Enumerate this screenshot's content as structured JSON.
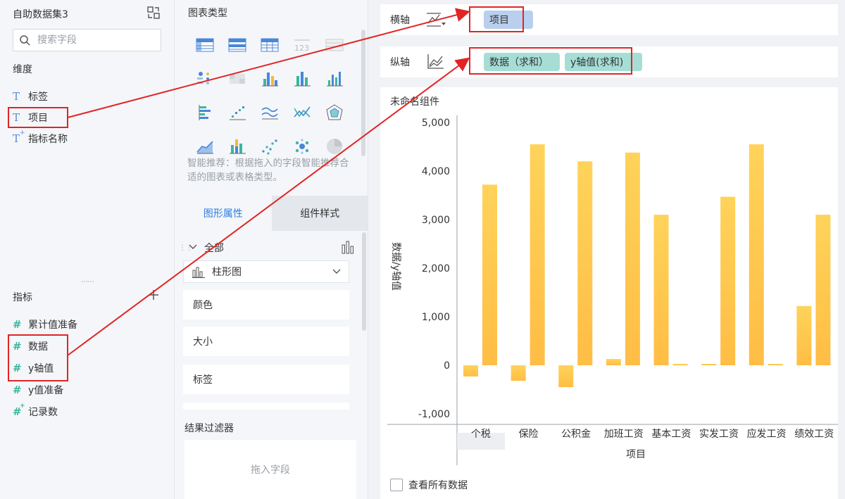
{
  "left": {
    "dataset_title": "自助数据集3",
    "search_placeholder": "搜索字段",
    "dimension_title": "维度",
    "dimensions": [
      "标签",
      "项目",
      "指标名称"
    ],
    "measure_title": "指标",
    "measures": [
      "累计值准备",
      "数据",
      "y轴值",
      "y值准备",
      "记录数"
    ],
    "add_icon": "plus-icon"
  },
  "middle": {
    "chart_type_title": "图表类型",
    "recommend_text": "智能推荐：根据拖入的字段智能推荐合适的图表或表格类型。",
    "tabs": [
      "图形属性",
      "组件样式"
    ],
    "all_label": "全部",
    "chart_type_value": "柱形图",
    "properties": [
      "颜色",
      "大小",
      "标签"
    ],
    "filter_title": "结果过滤器",
    "filter_placeholder": "拖入字段"
  },
  "right": {
    "x_axis_label": "横轴",
    "x_axis_fields": [
      "项目"
    ],
    "y_axis_label": "纵轴",
    "y_axis_fields": [
      "数据（求和）",
      "y轴值(求和)"
    ],
    "component_title": "未命名组件",
    "show_all_label": "查看所有数据"
  },
  "colors": {
    "accent": "#2f7de1",
    "bar_top": "#ffd35a",
    "bar_bottom": "#ffbd45",
    "annotation": "#e22424",
    "pill_blue": "#b9cfee",
    "pill_teal": "#a6ded6"
  },
  "chart_data": {
    "type": "bar",
    "xlabel": "项目",
    "ylabel": "数据/y轴值",
    "ylim": [
      -1000,
      5000
    ],
    "yticks": [
      "5,000",
      "4,000",
      "3,000",
      "2,000",
      "1,000",
      "0",
      "-1,000"
    ],
    "categories": [
      "个税",
      "保险",
      "公积金",
      "加班工资",
      "基本工资",
      "实发工资",
      "应发工资",
      "绩效工资"
    ],
    "series": [
      {
        "values": [
          -230,
          -320,
          -450,
          130,
          3100,
          0,
          4550,
          1220
        ]
      },
      {
        "values": [
          3720,
          4550,
          4200,
          4380,
          0,
          3470,
          0,
          3100
        ]
      }
    ],
    "grid": false,
    "legend": "none"
  }
}
